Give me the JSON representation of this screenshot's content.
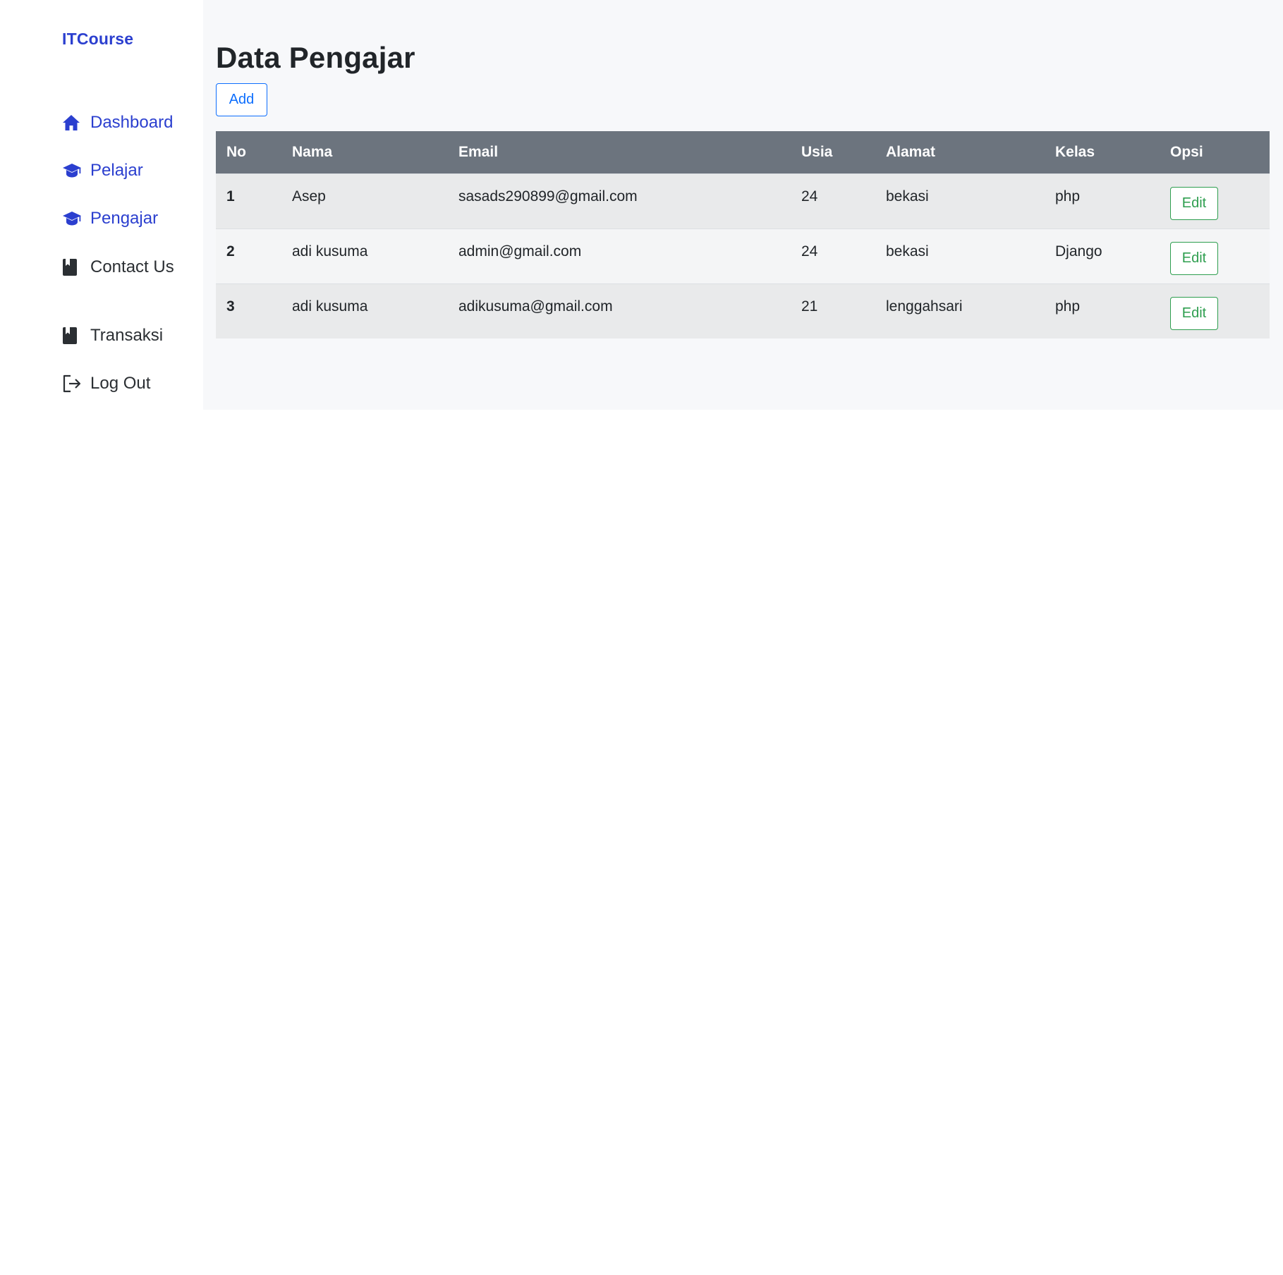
{
  "app": {
    "brand": "ITCourse"
  },
  "sidebar": {
    "items": [
      {
        "label": "Dashboard",
        "icon": "home-icon",
        "color": "#2b3fcf"
      },
      {
        "label": "Pelajar",
        "icon": "graduation-cap-icon",
        "color": "#2b3fcf"
      },
      {
        "label": "Pengajar",
        "icon": "graduation-cap-icon",
        "color": "#2b3fcf"
      },
      {
        "label": "Contact Us",
        "icon": "book-icon",
        "color": "#2b2f33"
      },
      {
        "label": "Transaksi",
        "icon": "book-icon",
        "color": "#2b2f33"
      },
      {
        "label": "Log Out",
        "icon": "logout-icon",
        "color": "#2b2f33"
      }
    ]
  },
  "main": {
    "title": "Data Pengajar",
    "add_label": "Add",
    "table": {
      "headers": [
        "No",
        "Nama",
        "Email",
        "Usia",
        "Alamat",
        "Kelas",
        "Opsi"
      ],
      "rows": [
        {
          "no": "1",
          "nama": "Asep",
          "email": "sasads290899@gmail.com",
          "usia": "24",
          "alamat": "bekasi",
          "kelas": "php",
          "opsi": "Edit"
        },
        {
          "no": "2",
          "nama": "adi kusuma",
          "email": "admin@gmail.com",
          "usia": "24",
          "alamat": "bekasi",
          "kelas": "Django",
          "opsi": "Edit"
        },
        {
          "no": "3",
          "nama": "adi kusuma",
          "email": "adikusuma@gmail.com",
          "usia": "21",
          "alamat": "lenggahsari",
          "kelas": "php",
          "opsi": "Edit"
        }
      ]
    }
  },
  "colors": {
    "brand": "#2b3fcf",
    "header_bg": "#6c747e",
    "add_button": "#0d6efd",
    "edit_button": "#2e9e4f"
  }
}
